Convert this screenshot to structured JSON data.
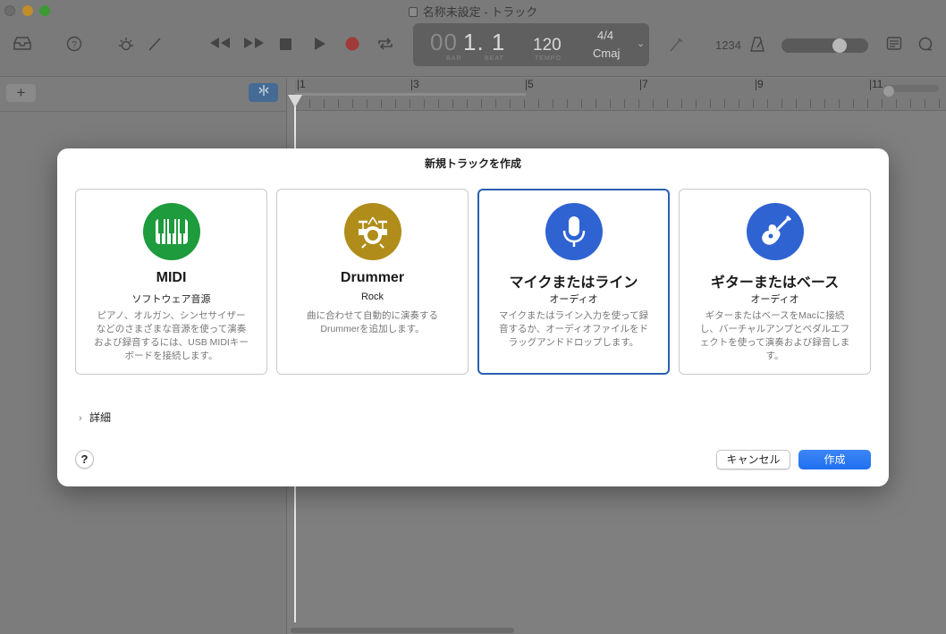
{
  "window": {
    "title": "名称未設定 - トラック"
  },
  "toolbar": {
    "icons": [
      "library-icon",
      "help-icon",
      "smart-controls-icon",
      "editors-icon",
      "rewind-icon",
      "fast-forward-icon",
      "stop-icon",
      "play-icon",
      "record-icon",
      "cycle-icon",
      "tuner-icon",
      "count-in-icon",
      "metronome-icon",
      "notepad-icon",
      "loops-icon"
    ],
    "count_in_label": "1234",
    "volume_level": 0.62
  },
  "lcd": {
    "bar_dim": "00",
    "position": "1. 1",
    "bar_label": "BAR",
    "beat_label": "BEAT",
    "tempo": "120",
    "tempo_label": "TEMPO",
    "time_signature": "4/4",
    "key": "Cmaj"
  },
  "tracks_panel": {
    "add_label": "+"
  },
  "ruler": {
    "bars": [
      "1",
      "3",
      "5",
      "7",
      "9",
      "11"
    ]
  },
  "dialog": {
    "title": "新規トラックを作成",
    "cards": [
      {
        "name": "MIDI",
        "subtitle": "ソフトウェア音源",
        "description": "ピアノ、オルガン、シンセサイザーなどのさまざまな音源を使って演奏および録音するには、USB MIDIキーボードを接続します。",
        "color": "#1e9b3c",
        "icon": "piano-keys-icon"
      },
      {
        "name": "Drummer",
        "subtitle": "Rock",
        "description": "曲に合わせて自動的に演奏するDrummerを追加します。",
        "color": "#b08d1a",
        "icon": "drum-kit-icon"
      },
      {
        "name": "マイクまたはライン",
        "subtitle": "オーディオ",
        "description": "マイクまたはライン入力を使って録音するか、オーディオファイルをドラッグアンドドロップします。",
        "color": "#2f63d2",
        "icon": "microphone-icon",
        "selected": true
      },
      {
        "name": "ギターまたはベース",
        "subtitle": "オーディオ",
        "description": "ギターまたはベースをMacに接続し、バーチャルアンプとペダルエフェクトを使って演奏および録音します。",
        "color": "#2f63d2",
        "icon": "guitar-icon"
      }
    ],
    "details_label": "詳細",
    "help_label": "?",
    "cancel_label": "キャンセル",
    "create_label": "作成"
  }
}
